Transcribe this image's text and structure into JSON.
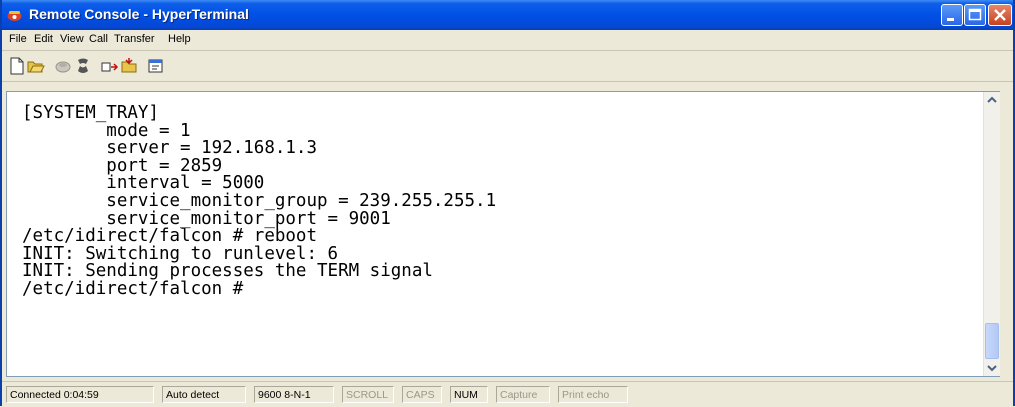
{
  "window": {
    "title": "Remote Console - HyperTerminal",
    "app_icon": "hyperterminal-phone-icon",
    "controls": [
      "minimize-icon",
      "maximize-icon",
      "close-icon"
    ]
  },
  "menu": {
    "file": "File",
    "edit": "Edit",
    "view": "View",
    "call": "Call",
    "transfer": "Transfer",
    "help": "Help"
  },
  "toolbar": {
    "icons": [
      "new-connection-icon",
      "open-icon",
      "disconnect-icon",
      "hang-up-icon",
      "send-icon",
      "receive-icon",
      "properties-icon"
    ]
  },
  "terminal": {
    "lines": [
      "[SYSTEM_TRAY]",
      "        mode = 1",
      "        server = 192.168.1.3",
      "        port = 2859",
      "        interval = 5000",
      "        service_monitor_group = 239.255.255.1",
      "        service_monitor_port = 9001",
      "/etc/idirect/falcon # reboot",
      "INIT: Switching to runlevel: 6",
      "INIT: Sending processes the TERM signal",
      "/etc/idirect/falcon #"
    ]
  },
  "status": {
    "connected": "Connected 0:04:59",
    "detect": "Auto detect",
    "settings": "9600 8-N-1",
    "scroll": "SCROLL",
    "caps": "CAPS",
    "num": "NUM",
    "capture": "Capture",
    "print_echo": "Print echo"
  },
  "colors": {
    "titlebar": "#0050e6",
    "terminal_bg": "#ffffff",
    "terminal_text": "#000000",
    "chrome": "#ece9d8"
  }
}
